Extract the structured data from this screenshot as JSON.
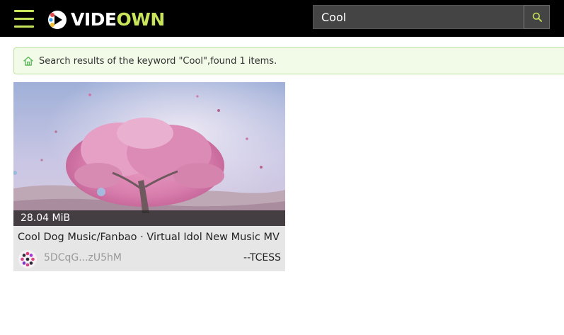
{
  "header": {
    "logo_part1": "VIDE",
    "logo_part2": "OWN",
    "search_value": "Cool",
    "colors": {
      "background": "#000000",
      "accent": "#c8e45a"
    },
    "icons": {
      "menu": "hamburger-icon",
      "search": "search-icon"
    }
  },
  "notice": {
    "text": "Search results of the keyword \"Cool\",found 1 items.",
    "icon": "home-icon",
    "colors": {
      "background": "#f1fbe8",
      "border": "#b9e39a",
      "icon": "#5cb85c"
    }
  },
  "results": [
    {
      "size": "28.04 MiB",
      "title": "Cool Dog Music/Fanbao · Virtual Idol New Music MV",
      "address": "5DCqG...zU5hM",
      "author": "--TCESS"
    }
  ]
}
